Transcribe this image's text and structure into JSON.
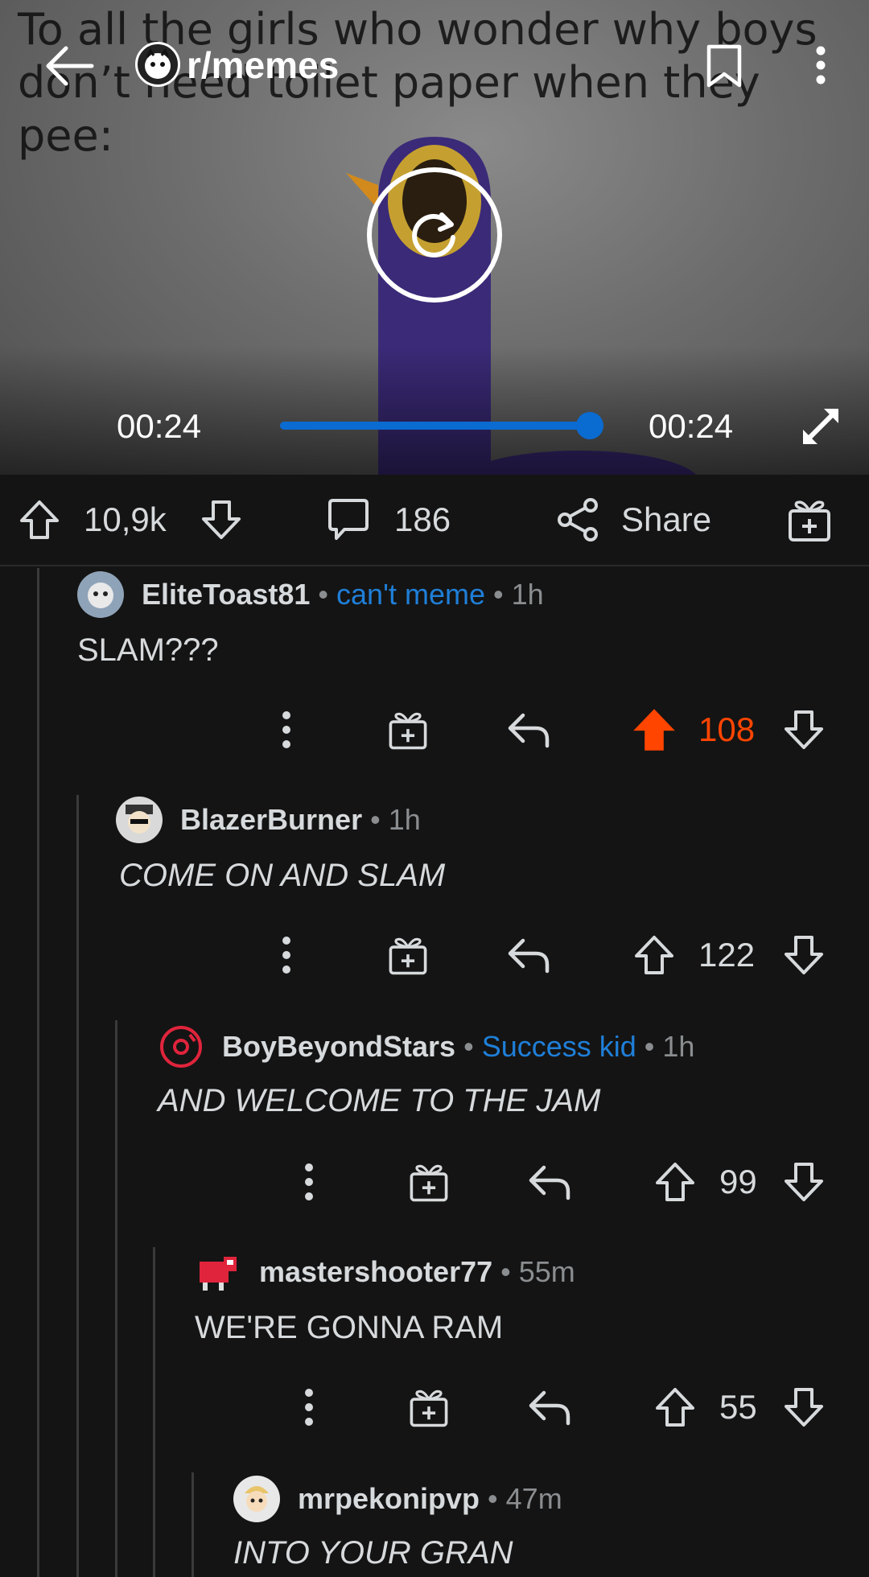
{
  "video": {
    "caption": "To all the girls who wonder why boys don’t need toilet paper when they pee:",
    "subreddit": "r/memes",
    "current_time": "00:24",
    "duration": "00:24",
    "progress": 1.0
  },
  "post_actions": {
    "score": "10,9k",
    "comments": "186",
    "share_label": "Share"
  },
  "comments": [
    {
      "user": "EliteToast81",
      "flair": "can't meme",
      "time": "1h",
      "body": "SLAM???",
      "score": "108",
      "upvoted": true
    },
    {
      "user": "BlazerBurner",
      "flair": "",
      "time": "1h",
      "body": "COME ON AND SLAM",
      "score": "122",
      "upvoted": false
    },
    {
      "user": "BoyBeyondStars",
      "flair": "Success kid",
      "time": "1h",
      "body": "AND WELCOME TO THE JAM",
      "score": "99",
      "upvoted": false
    },
    {
      "user": "mastershooter77",
      "flair": "",
      "time": "55m",
      "body": "WE'RE GONNA RAM",
      "score": "55",
      "upvoted": false
    },
    {
      "user": "mrpekonipvp",
      "flair": "",
      "time": "47m",
      "body": "INTO YOUR GRAN",
      "score": "",
      "upvoted": false
    }
  ],
  "colors": {
    "accent": "#0a6bd0",
    "upvote": "#ff4500",
    "flair": "#1f7fd8",
    "background": "#141414"
  }
}
